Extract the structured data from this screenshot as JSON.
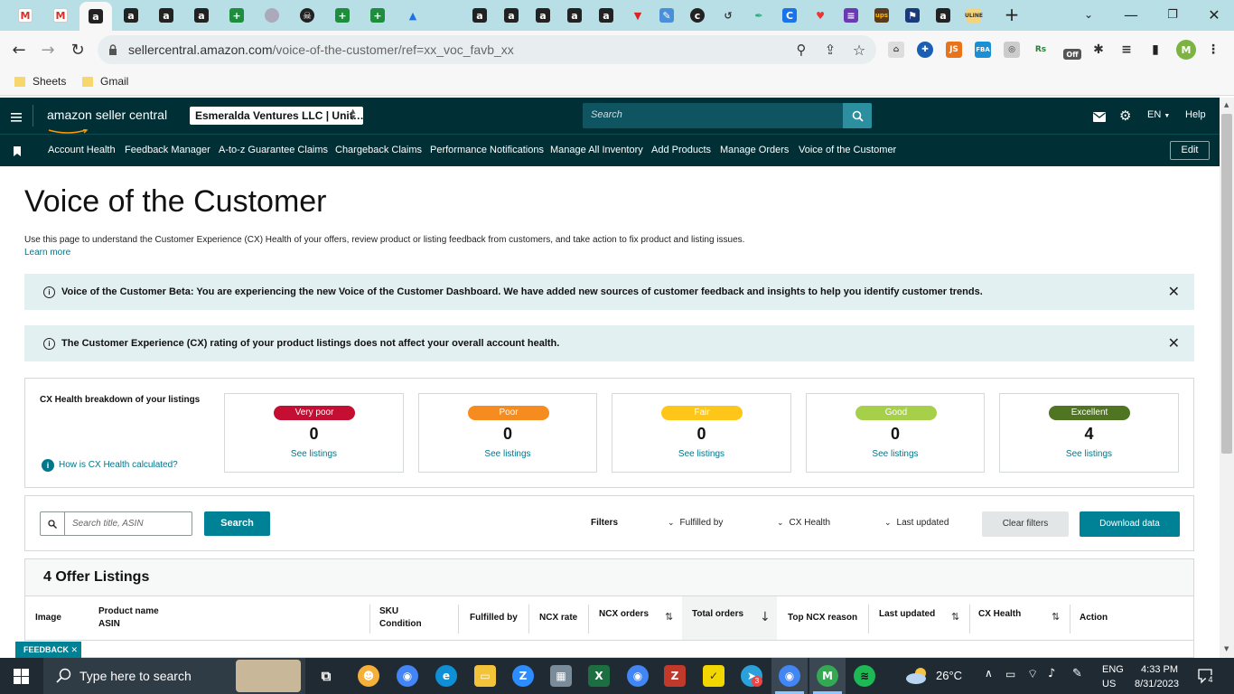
{
  "browser": {
    "tab_favicons": [
      "gmail-m",
      "gmail-m",
      "amazon-a",
      "amazon-a",
      "amazon-a",
      "amazon-a",
      "sheets-plus",
      "circle-gray",
      "pirate",
      "sheets-plus",
      "sheets-plus",
      "drive",
      "amazon-a",
      "amazon-a",
      "amazon-a",
      "amazon-a",
      "amazon-a",
      "red-triangle",
      "pencil",
      "dark-c",
      "history",
      "pen",
      "c-blue",
      "heart",
      "list-purple",
      "ups",
      "flag",
      "amazon-a",
      "uline"
    ],
    "new_tab_label": "+",
    "url_host": "sellercentral.amazon.com",
    "url_path": "/voice-of-the-customer/ref=xx_voc_favb_xx",
    "extension_badge": "Off",
    "profile_initial": "M",
    "bookmarks": [
      "Sheets",
      "Gmail"
    ]
  },
  "header": {
    "logo_text": "amazon seller central",
    "store_selector": "Esmeralda Ventures LLC | Unit…",
    "search_placeholder": "Search",
    "language": "EN",
    "help": "Help"
  },
  "nav": {
    "links": [
      "Account Health",
      "Feedback Manager",
      "A-to-z Guarantee Claims",
      "Chargeback Claims",
      "Performance Notifications",
      "Manage All Inventory",
      "Add Products",
      "Manage Orders",
      "Voice of the Customer"
    ],
    "edit_label": "Edit"
  },
  "page": {
    "title": "Voice of the Customer",
    "description": "Use this page to understand the Customer Experience (CX) Health of your offers, review product or listing feedback from customers, and take action to fix product and listing issues.",
    "learn_more": "Learn more"
  },
  "alerts": [
    {
      "text": "Voice of the Customer Beta: You are experiencing the new Voice of the Customer Dashboard. We have added new sources of customer feedback and insights to help you identify customer trends."
    },
    {
      "text": "The Customer Experience (CX) rating of your product listings does not affect your overall account health."
    }
  ],
  "cx_health": {
    "heading": "CX Health breakdown of your listings",
    "help_link": "How is CX Health calculated?",
    "cards": [
      {
        "label": "Very poor",
        "count": "0",
        "link": "See listings",
        "color": "#c40e32"
      },
      {
        "label": "Poor",
        "count": "0",
        "link": "See listings",
        "color": "#f68b1f"
      },
      {
        "label": "Fair",
        "count": "0",
        "link": "See listings",
        "color": "#ffc61a"
      },
      {
        "label": "Good",
        "count": "0",
        "link": "See listings",
        "color": "#a7d04a"
      },
      {
        "label": "Excellent",
        "count": "4",
        "link": "See listings",
        "color": "#4f7422"
      }
    ]
  },
  "filters": {
    "search_placeholder": "Search title, ASIN",
    "search_button": "Search",
    "filters_label": "Filters",
    "fulfilled_by": "Fulfilled by",
    "cx_health": "CX Health",
    "last_updated": "Last updated",
    "clear_filters": "Clear filters",
    "download": "Download data"
  },
  "table": {
    "title": "4 Offer Listings",
    "columns": {
      "image": "Image",
      "product_name": "Product name",
      "asin": "ASIN",
      "sku": "SKU",
      "condition": "Condition",
      "fulfilled_by": "Fulfilled by",
      "ncx_rate": "NCX rate",
      "ncx_orders": "NCX orders",
      "total_orders": "Total orders",
      "top_ncx_reason": "Top NCX reason",
      "last_updated": "Last updated",
      "cx_health": "CX Health",
      "action": "Action"
    }
  },
  "feedback_tab": "FEEDBACK",
  "taskbar": {
    "search_placeholder": "Type here to search",
    "weather": "26°C",
    "lang_top": "ENG",
    "lang_bottom": "US",
    "time": "4:33 PM",
    "date": "8/31/2023",
    "notifications": "4",
    "badge_count": "3"
  }
}
